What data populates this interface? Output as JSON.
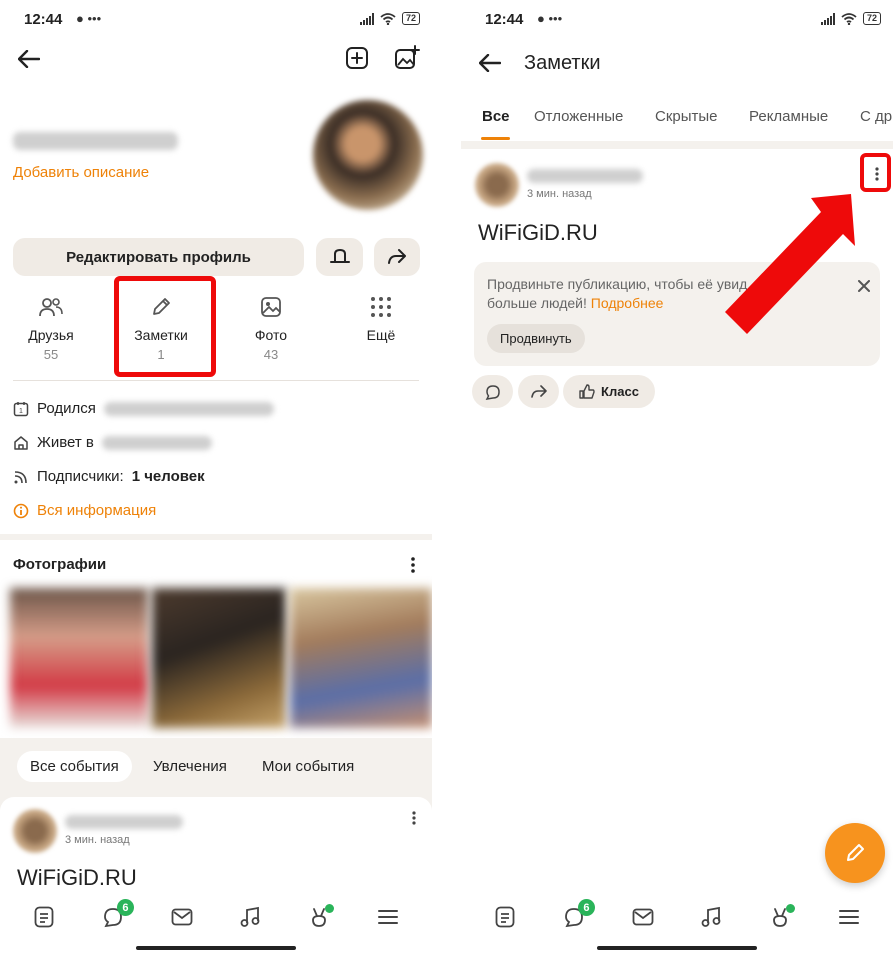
{
  "status_bar": {
    "time": "12:44",
    "battery": "72"
  },
  "left_screen": {
    "add_description": "Добавить описание",
    "edit_profile_button": "Редактировать профиль",
    "stats": [
      {
        "label": "Друзья",
        "count": "55",
        "icon": "friends-icon"
      },
      {
        "label": "Заметки",
        "count": "1",
        "icon": "pencil-icon"
      },
      {
        "label": "Фото",
        "count": "43",
        "icon": "photo-icon"
      },
      {
        "label": "Ещё",
        "count": "",
        "icon": "grid-icon"
      }
    ],
    "info": {
      "born_label": "Родился",
      "lives_label": "Живет в",
      "followers_label": "Подписчики:",
      "followers_value": "1 человек",
      "all_info_link": "Вся информация"
    },
    "photos_title": "Фотографии",
    "feed_chips": [
      "Все события",
      "Увлечения",
      "Мои события"
    ],
    "post": {
      "time": "3 мин. назад",
      "text": "WiFiGiD.RU"
    }
  },
  "right_screen": {
    "title": "Заметки",
    "tabs": [
      "Все",
      "Отложенные",
      "Скрытые",
      "Рекламные",
      "С др"
    ],
    "post": {
      "time": "3 мин. назад",
      "text": "WiFiGiD.RU",
      "promo_text": "Продвиньте публикацию, чтобы её увид",
      "promo_text2": "больше людей!",
      "promo_link": "Подробнее",
      "promo_button": "Продвинуть",
      "reaction_class": "Класс"
    }
  },
  "bottom_nav": {
    "chat_badge": "6"
  },
  "colors": {
    "accent": "#ee8208",
    "highlight_red": "#ee0a0a",
    "badge_green": "#2ab45a",
    "fab_orange": "#f7931e"
  }
}
